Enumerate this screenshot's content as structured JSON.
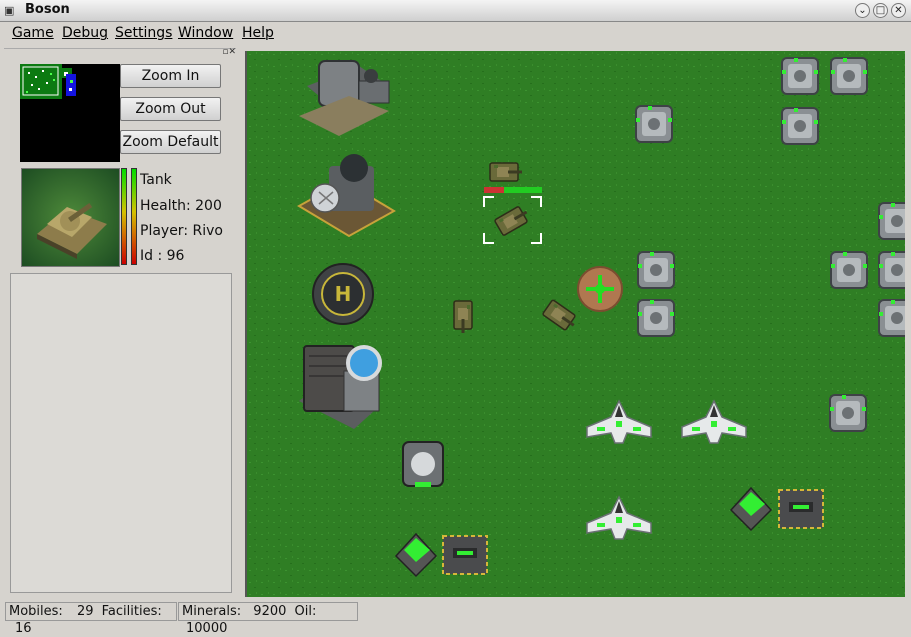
{
  "window": {
    "title": "Boson"
  },
  "menu": [
    "Game",
    "Debug",
    "Settings",
    "Window",
    "Help"
  ],
  "sidebar": {
    "zoom_in": "Zoom In",
    "zoom_out": "Zoom Out",
    "zoom_default": "Zoom Default",
    "unit": {
      "type": "Tank",
      "health": "Health: 200",
      "player": "Player: Rivo",
      "id": "Id : 96"
    }
  },
  "status": {
    "mobiles_label": "Mobiles:",
    "mobiles_value": "29",
    "facilities_label": "Facilities:",
    "facilities_value": "16",
    "minerals_label": "Minerals:",
    "minerals_value": "9200",
    "oil_label": "Oil:",
    "oil_value": "10000"
  },
  "colors": {
    "grass": "#2e7d23",
    "selection": "#ffffff",
    "health_bar": "#22cc22",
    "accent_green": "#33ee33"
  },
  "icons": {
    "app": "app-menu-icon",
    "minimize": "minimize-icon",
    "maximize": "maximize-icon",
    "close": "close-icon"
  }
}
